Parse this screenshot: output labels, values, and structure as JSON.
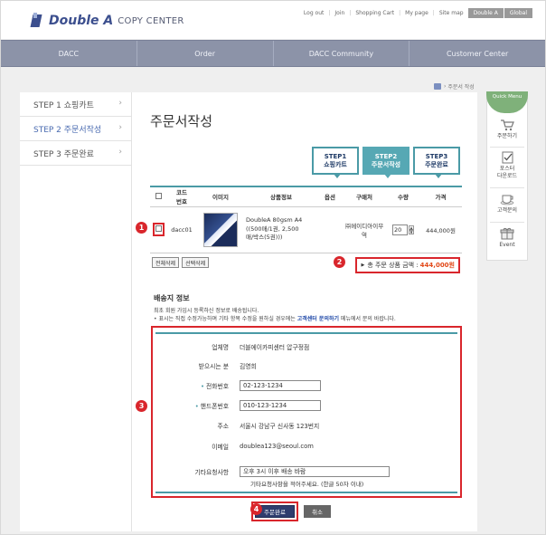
{
  "header": {
    "brand": "Double A",
    "subtitle": "COPY CENTER",
    "util_links": [
      "Log out",
      "Join",
      "Shopping Cart",
      "My page",
      "Site map"
    ],
    "util_buttons": [
      "Double A",
      "Global"
    ]
  },
  "nav": [
    "DACC",
    "Order",
    "DACC Community",
    "Customer Center"
  ],
  "breadcrumb": "주문서 작성",
  "sidebar": [
    {
      "label": "STEP 1 쇼핑카트",
      "active": false
    },
    {
      "label": "STEP 2 주문서작성",
      "active": true
    },
    {
      "label": "STEP 3 주문완료",
      "active": false
    }
  ],
  "page_title": "주문서작성",
  "steps": [
    {
      "line1": "STEP1",
      "line2": "쇼핑카트",
      "active": false
    },
    {
      "line1": "STEP2",
      "line2": "주문서작성",
      "active": true
    },
    {
      "line1": "STEP3",
      "line2": "주문완료",
      "active": false
    }
  ],
  "table": {
    "headers": [
      "",
      "코드번호",
      "이미지",
      "상품정보",
      "옵션",
      "구매처",
      "수량",
      "가격"
    ],
    "code_header_lines": [
      "코드",
      "번호"
    ],
    "row": {
      "code": "dacc01",
      "product_lines": [
        "DoubleA 80gsm A4",
        "((500매/1권, 2,500",
        "매/박스(5권)))"
      ],
      "option": "",
      "vendor_lines": [
        "㈜메이디아이무",
        "역"
      ],
      "qty": "20",
      "price": "444,000원"
    }
  },
  "buttons": {
    "delete_all": "전체삭제",
    "delete_selected": "선택삭제",
    "submit": "주문완료",
    "cancel": "취소"
  },
  "total": {
    "label": "총 주문 상품 금액 :",
    "amount": "444,000원"
  },
  "shipping": {
    "title": "배송지 정보",
    "note1": "최초 회원 가입시 등록하신 정보로 배송됩니다.",
    "note2_pre": "표시는 직접 수정가능하며 기타 항목 수정을 원하실 경우에는",
    "note2_link": "고객센터 문의하기",
    "note2_post": "메뉴에서 문의 바랍니다.",
    "fields": {
      "company_label": "업체명",
      "company": "더블에이카피센터 압구정점",
      "recipient_label": "받으시는 분",
      "recipient": "김영희",
      "phone_label": "전화번호",
      "phone": "02-123-1234",
      "mobile_label": "핸드폰번호",
      "mobile": "010-123-1234",
      "address_label": "주소",
      "address": "서울시 강남구 신사동 123번지",
      "email_label": "이메일",
      "email": "doublea123@seoul.com",
      "request_label": "기타요청사항",
      "request": "오후 3시 이후 배송 바람",
      "request_helper": "기타요청사항을 적어주세요. (한글 50자 이내)"
    }
  },
  "markers": [
    "1",
    "2",
    "3",
    "4"
  ],
  "quick_menu": {
    "title_lines": [
      "Quick",
      "Menu"
    ],
    "items": [
      {
        "label_lines": [
          "주문하기"
        ],
        "icon": "cart-icon"
      },
      {
        "label_lines": [
          "포스터",
          "다운로드"
        ],
        "icon": "checkbox-icon"
      },
      {
        "label_lines": [
          "고객문의"
        ],
        "icon": "coffee-cup-icon"
      },
      {
        "label_lines": [
          "Event"
        ],
        "icon": "gift-icon"
      }
    ]
  },
  "colors": {
    "accent_teal": "#4a9aa6",
    "highlight_red": "#d9262c",
    "nav_bg": "#8c93a8",
    "total_amount": "#e24a1a"
  }
}
